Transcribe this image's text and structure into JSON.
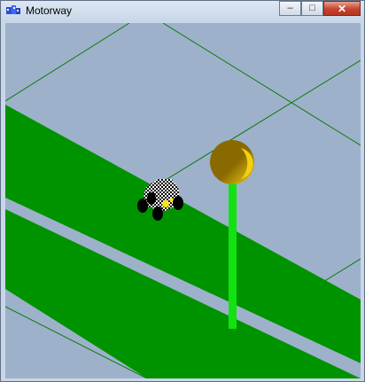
{
  "window": {
    "title": "Motorway",
    "icon": "motorway-app-icon",
    "controls": {
      "minimize_glyph": "–",
      "maximize_glyph": "□",
      "close_glyph": "✕"
    }
  },
  "scene": {
    "colors": {
      "ground": "#9eb1cb",
      "road": "#009300",
      "grid_lines": "#0a7a0a",
      "pole": "#12e212",
      "lamp": "#8a6a00",
      "lamp_highlight": "#f2cf12",
      "car_body": "#ffffff",
      "car_pattern": "#000000",
      "wheels": "#000000",
      "headlight": "#f7e51a"
    }
  }
}
